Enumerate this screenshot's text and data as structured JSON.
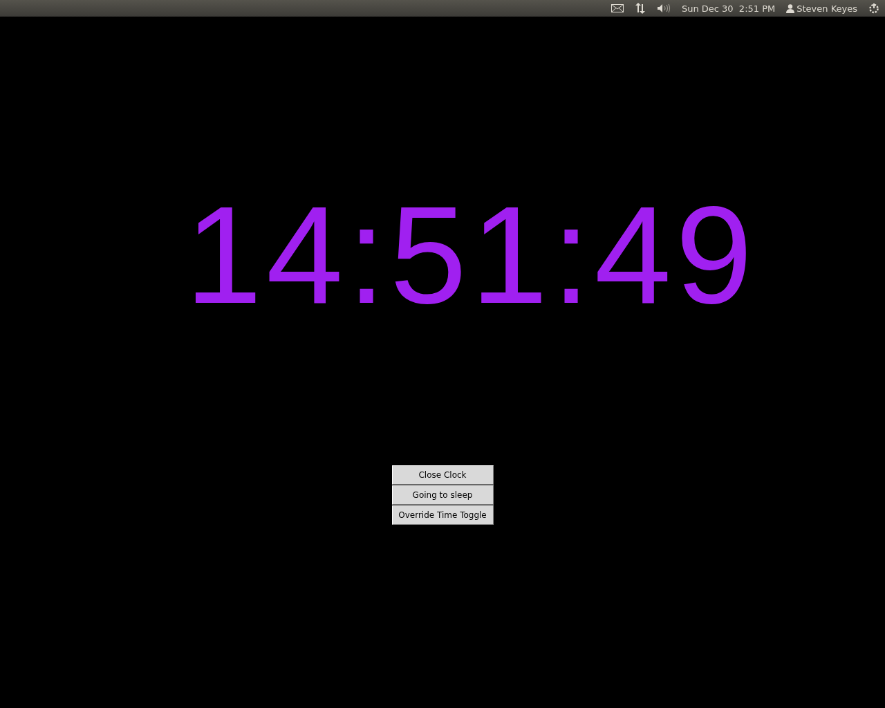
{
  "top_panel": {
    "datetime": "Sun Dec 30  2:51 PM",
    "user": "Steven Keyes"
  },
  "clock": {
    "time": "14:51:49",
    "color": "#a020f0"
  },
  "buttons": [
    "Close Clock",
    "Going to sleep",
    "Override Time Toggle"
  ]
}
